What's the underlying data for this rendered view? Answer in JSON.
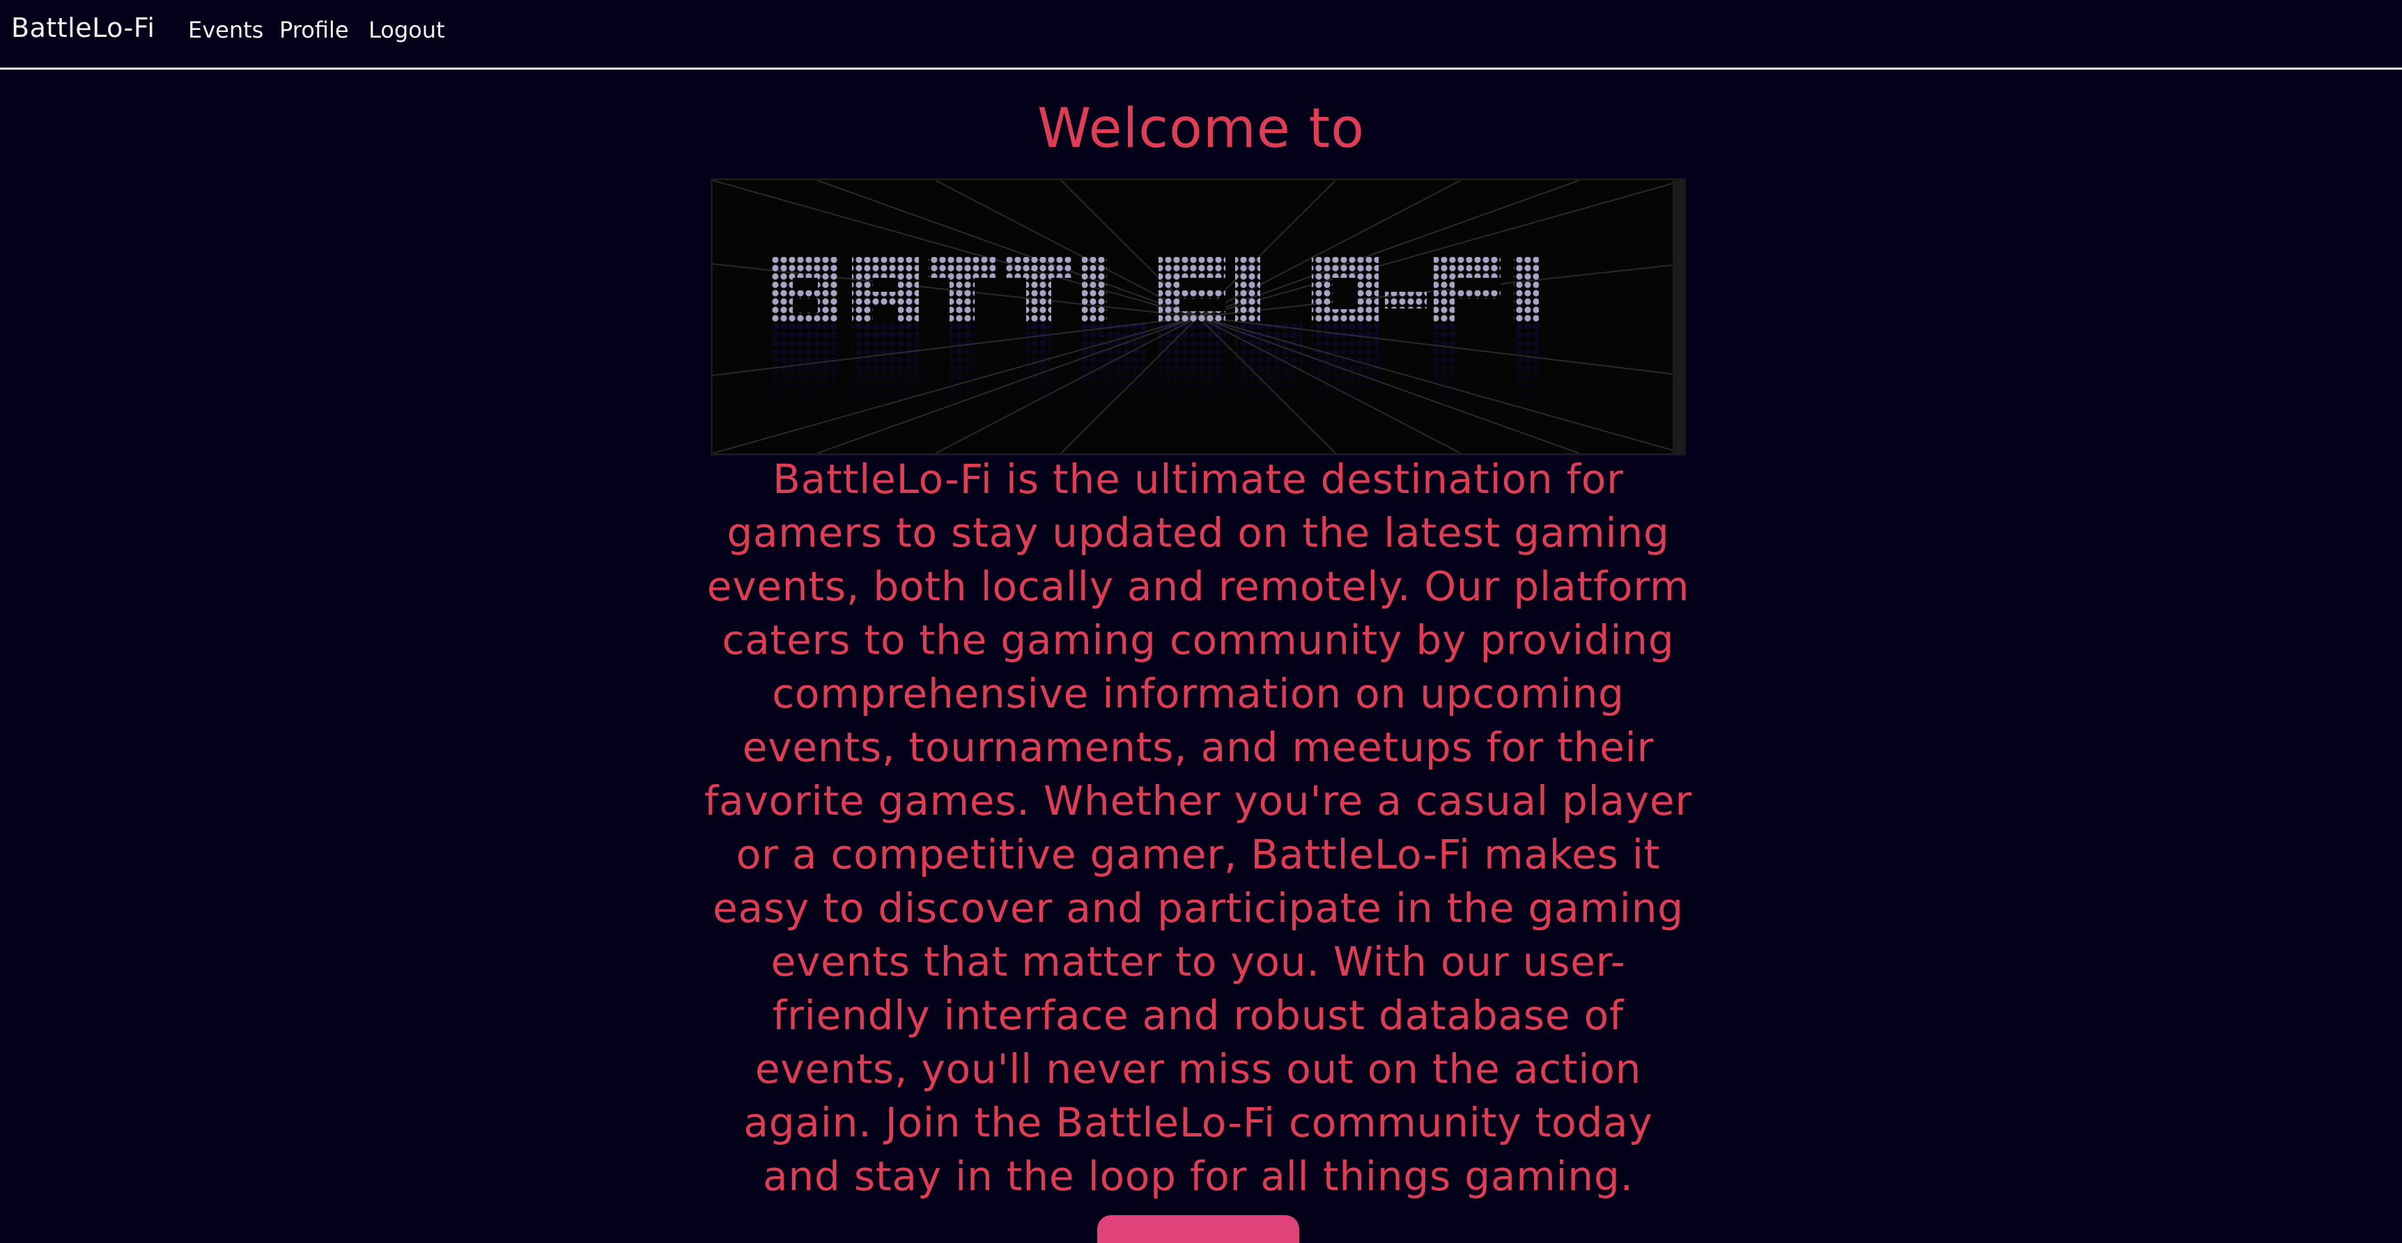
{
  "nav": {
    "brand": "BattleLo-Fi",
    "links": [
      "Events",
      "Profile",
      "Logout"
    ]
  },
  "hero": {
    "heading": "Welcome to",
    "logo_text": "BATTLELO-FI",
    "description": "BattleLo-Fi is the ultimate destination for gamers to stay updated on the latest gaming events, both locally and remotely. Our platform caters to the gaming community by providing comprehensive information on upcoming events, tournaments, and meetups for their favorite games. Whether you're a casual player or a competitive gamer, BattleLo-Fi makes it easy to discover and participate in the gaming events that matter to you. With our user-friendly interface and robust database of events, you'll never miss out on the action again. Join the BattleLo-Fi community today and stay in the loop for all things gaming."
  },
  "colors": {
    "background": "#03011a",
    "accent_text": "#df3c55",
    "nav_text": "#f2f2f2",
    "button": "#e0427a"
  }
}
